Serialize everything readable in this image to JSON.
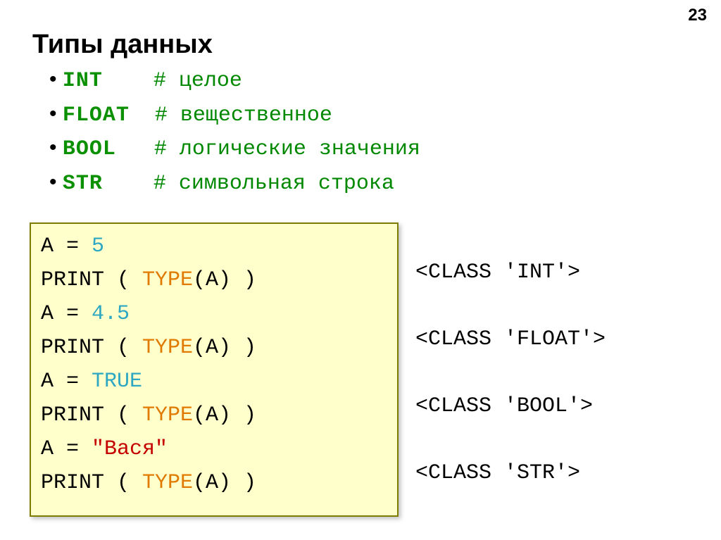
{
  "page_number": "23",
  "title": "Типы данных",
  "types": [
    {
      "keyword": "INT",
      "pad": "    ",
      "comment": "# целое"
    },
    {
      "keyword": "FLOAT",
      "pad": "  ",
      "comment": "# вещественное"
    },
    {
      "keyword": "BOOL",
      "pad": "   ",
      "comment": "# логические значения"
    },
    {
      "keyword": "STR",
      "pad": "    ",
      "comment": "# символьная строка"
    }
  ],
  "code": {
    "l1_left": "A = ",
    "l1_val": "5",
    "l2_left": "PRINT ( ",
    "l2_fn": "TYPE",
    "l2_right": "(A) )",
    "l3_left": "A = ",
    "l3_val": "4.5",
    "l4_left": "PRINT ( ",
    "l4_fn": "TYPE",
    "l4_right": "(A) )",
    "l5_left": "A = ",
    "l5_val": "TRUE",
    "l6_left": "PRINT ( ",
    "l6_fn": "TYPE",
    "l6_right": "(A) )",
    "l7_left": "A = ",
    "l7_val": "\"Вася\"",
    "l8_left": "PRINT ( ",
    "l8_fn": "TYPE",
    "l8_right": "(A) )"
  },
  "outputs": {
    "o1": "<CLASS 'INT'>",
    "o2": "<CLASS 'FLOAT'>",
    "o3": "<CLASS 'BOOL'>",
    "o4": "<CLASS 'STR'>"
  }
}
